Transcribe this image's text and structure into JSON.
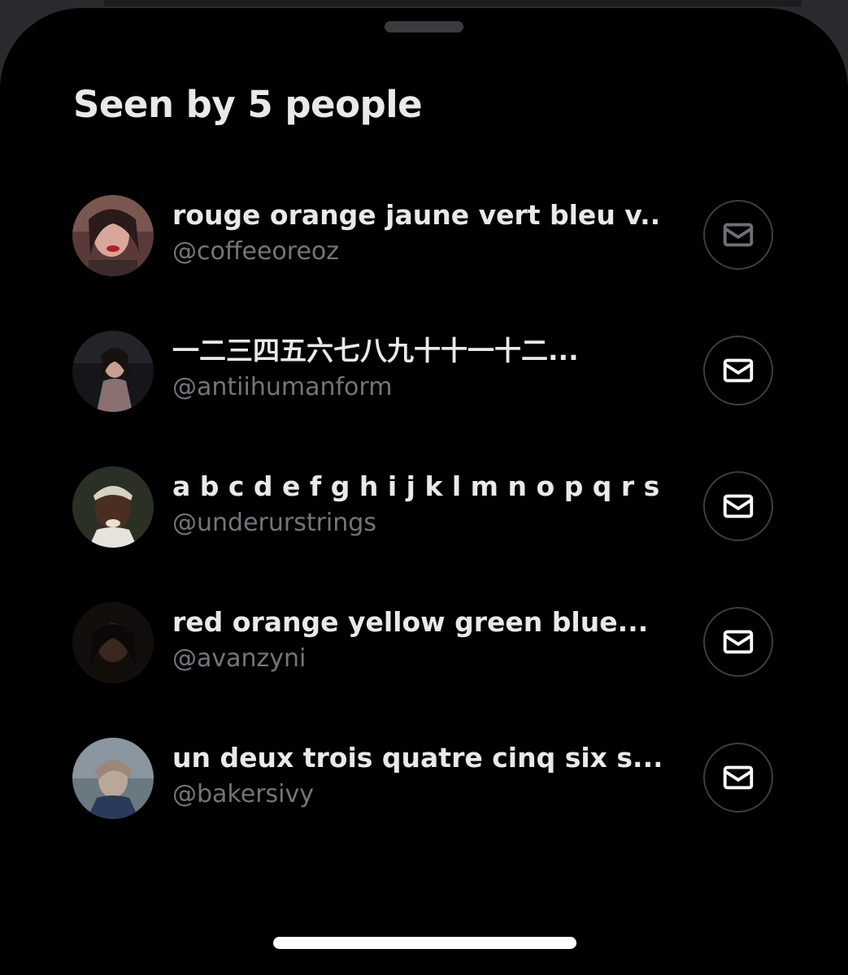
{
  "sheet": {
    "title": "Seen by 5 people"
  },
  "viewers": [
    {
      "name": "rouge orange jaune vert bleu v...",
      "handle": "@coffeeoreoz",
      "dm_enabled": false
    },
    {
      "name": "一二三四五六七八九十十一十二...",
      "handle": "@antiihumanform",
      "dm_enabled": true
    },
    {
      "name": "a b c d e f g h i j k l m n o p q r s...",
      "handle": "@underurstrings",
      "dm_enabled": true
    },
    {
      "name": "red orange yellow green blue...",
      "handle": "@avanzyni",
      "dm_enabled": true
    },
    {
      "name": "un deux trois quatre cinq six s...",
      "handle": "@bakersivy",
      "dm_enabled": true
    }
  ],
  "icons": {
    "dm_button": "envelope-icon"
  },
  "colors": {
    "background": "#000000",
    "primary_text": "#e7e9ea",
    "secondary_text": "#71767b",
    "button_border": "#3b3e42",
    "disabled_icon": "#6e7175",
    "enabled_icon": "#ffffff"
  }
}
